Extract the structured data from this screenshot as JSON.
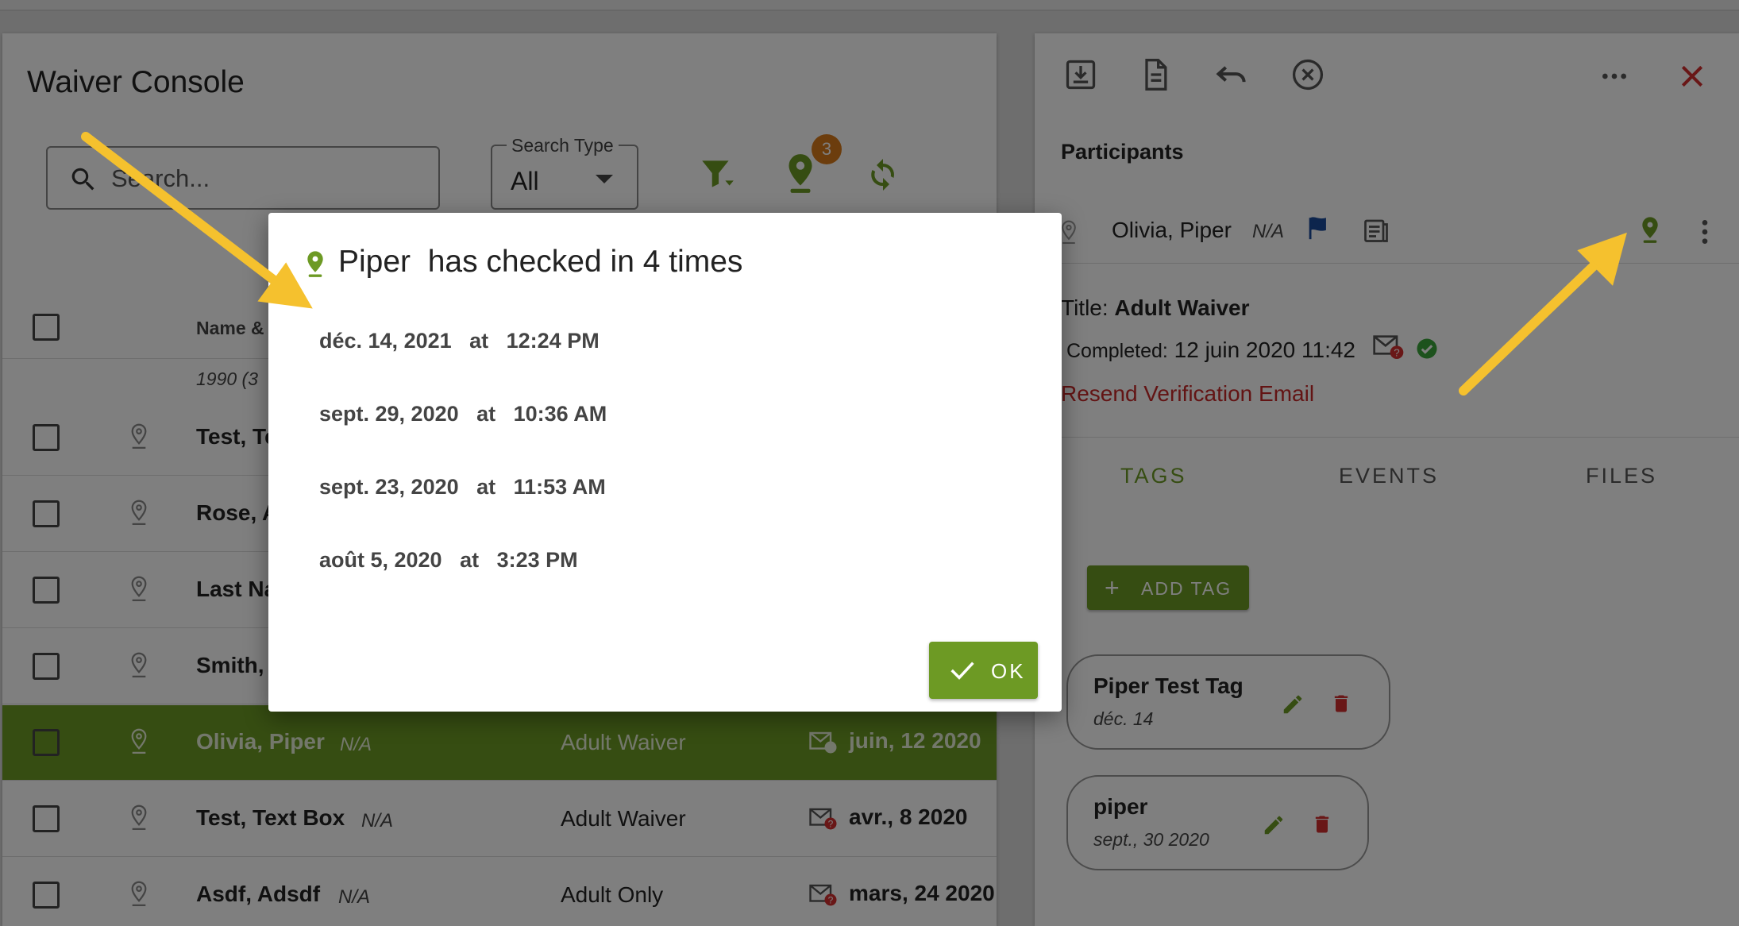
{
  "console": {
    "title": "Waiver Console",
    "search_placeholder": "Search...",
    "search_type_label": "Search Type",
    "search_type_value": "All",
    "checkin_badge": "3"
  },
  "table": {
    "header_name": "Name &",
    "partial_row_text": "1990 (3",
    "rows": [
      {
        "name": "Test, Te",
        "na": "",
        "title": "",
        "date": ""
      },
      {
        "name": "Rose, A",
        "na": "",
        "title": "",
        "date": ""
      },
      {
        "name": "Last Na",
        "na": "",
        "title": "",
        "date": ""
      },
      {
        "name": "Smith, V",
        "na": "",
        "title": "",
        "date": ""
      },
      {
        "name": "Olivia, Piper",
        "na": "N/A",
        "title": "Adult Waiver",
        "date": "juin, 12 2020"
      },
      {
        "name": "Test, Text Box",
        "na": "N/A",
        "title": "Adult Waiver",
        "date": "avr., 8 2020"
      },
      {
        "name": "Asdf, Adsdf",
        "na": "N/A",
        "title": "Adult Only",
        "date": "mars, 24 2020"
      }
    ]
  },
  "details": {
    "participants_label": "Participants",
    "participant_name": "Olivia, Piper",
    "participant_na": "N/A",
    "title_label": "Title:",
    "title_value": "Adult Waiver",
    "completed_label": "Completed:",
    "completed_value": "12 juin 2020 11:42",
    "resend_label": "Resend Verification Email",
    "tabs": [
      "TAGS",
      "EVENTS",
      "FILES"
    ],
    "add_tag_label": "ADD TAG",
    "tags": [
      {
        "name": "Piper Test Tag",
        "date": "déc. 14"
      },
      {
        "name": "piper",
        "date": "sept., 30 2020"
      }
    ]
  },
  "dialog": {
    "title": "Piper  has checked in 4 times",
    "checkins": [
      "déc. 14, 2021   at   12:24 PM",
      "sept. 29, 2020   at   10:36 AM",
      "sept. 23, 2020   at   11:53 AM",
      "août 5, 2020   at   3:23 PM"
    ],
    "ok_label": "OK"
  },
  "colors": {
    "accent_green": "#6d9a24",
    "danger_red": "#c62828",
    "badge_orange": "#d97a1a",
    "arrow_yellow": "#f5c12e"
  },
  "icons": [
    "search-icon",
    "filter-icon",
    "location-pin-icon",
    "refresh-icon",
    "download-icon",
    "document-icon",
    "undo-icon",
    "cancel-circle-icon",
    "more-horizontal-icon",
    "close-icon",
    "flag-icon",
    "id-card-icon",
    "more-vertical-icon",
    "mail-error-icon",
    "verified-check-icon",
    "plus-icon",
    "edit-icon",
    "delete-icon",
    "check-icon",
    "arrow-annotation"
  ]
}
